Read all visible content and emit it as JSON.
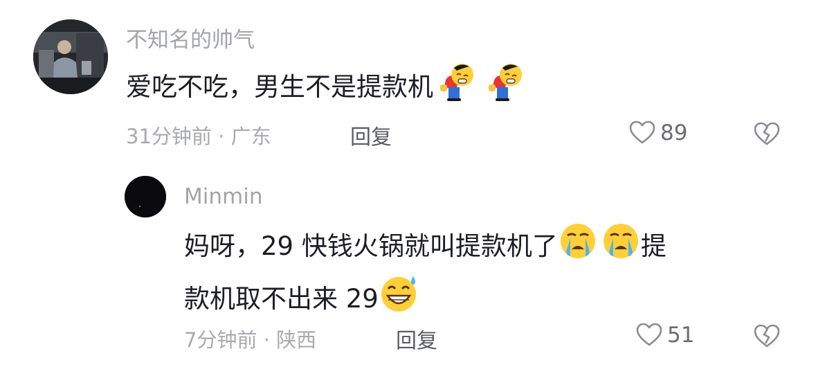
{
  "comments": [
    {
      "username": "不知名的帅气",
      "text": "爱吃不吃，男生不是提款机",
      "trailing_emojis": [
        "bow-emoji",
        "bow-emoji"
      ],
      "timestamp": "31分钟前",
      "location": "广东",
      "reply_label": "回复",
      "like_count": "89"
    },
    {
      "username": "Minmin",
      "text_line1": "妈呀，29 快钱火锅就叫提款机了",
      "text_line1_emojis": [
        "crying-emoji",
        "crying-emoji"
      ],
      "text_line1_tail": "提",
      "text_line2": "款机取不出来 29",
      "text_line2_emojis": [
        "grinning-sweat-emoji"
      ],
      "timestamp": "7分钟前",
      "location": "陕西",
      "reply_label": "回复",
      "like_count": "51"
    }
  ],
  "separator": "·"
}
